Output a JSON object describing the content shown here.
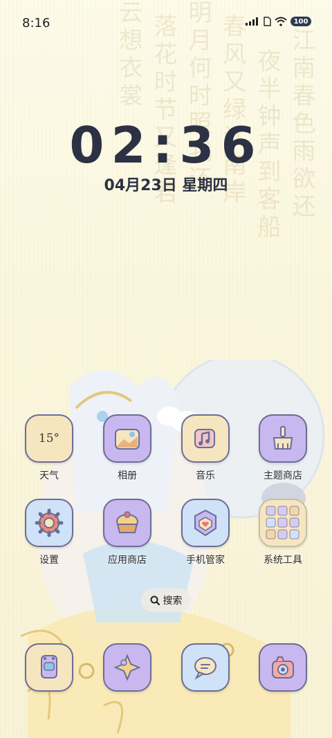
{
  "status_bar": {
    "time": "8:16",
    "battery": "100"
  },
  "lock_clock": {
    "time": "02:36",
    "date": "04月23日 星期四"
  },
  "apps": [
    {
      "label": "天气",
      "icon": "weather-icon",
      "temp": "15°"
    },
    {
      "label": "相册",
      "icon": "gallery-icon"
    },
    {
      "label": "音乐",
      "icon": "music-icon"
    },
    {
      "label": "主题商店",
      "icon": "theme-store-icon"
    },
    {
      "label": "设置",
      "icon": "settings-icon"
    },
    {
      "label": "应用商店",
      "icon": "app-store-icon"
    },
    {
      "label": "手机管家",
      "icon": "phone-manager-icon"
    },
    {
      "label": "系统工具",
      "icon": "system-tools-folder-icon"
    }
  ],
  "search": {
    "label": "搜索"
  },
  "dock": [
    {
      "icon": "phone-app-icon"
    },
    {
      "icon": "star-app-icon"
    },
    {
      "icon": "messages-icon"
    },
    {
      "icon": "camera-icon"
    }
  ],
  "colors": {
    "accent": "#6a6d96",
    "clock": "#2c3244",
    "purple": "#c9b8ef",
    "cream": "#f6e6bf",
    "blue": "#cfe2f7"
  }
}
